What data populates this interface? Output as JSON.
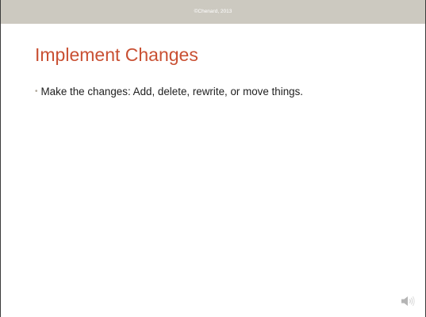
{
  "header": {
    "copyright": "©Chenard, 2013"
  },
  "slide": {
    "title": "Implement Changes",
    "bullets": [
      {
        "marker": "•",
        "text": "Make the changes: Add, delete, rewrite, or move things."
      }
    ]
  },
  "icons": {
    "audio": "speaker-icon"
  },
  "colors": {
    "title": "#c95033",
    "band": "#ccc9c0",
    "bullet": "#b0a89b",
    "text": "#1e1e1e"
  }
}
